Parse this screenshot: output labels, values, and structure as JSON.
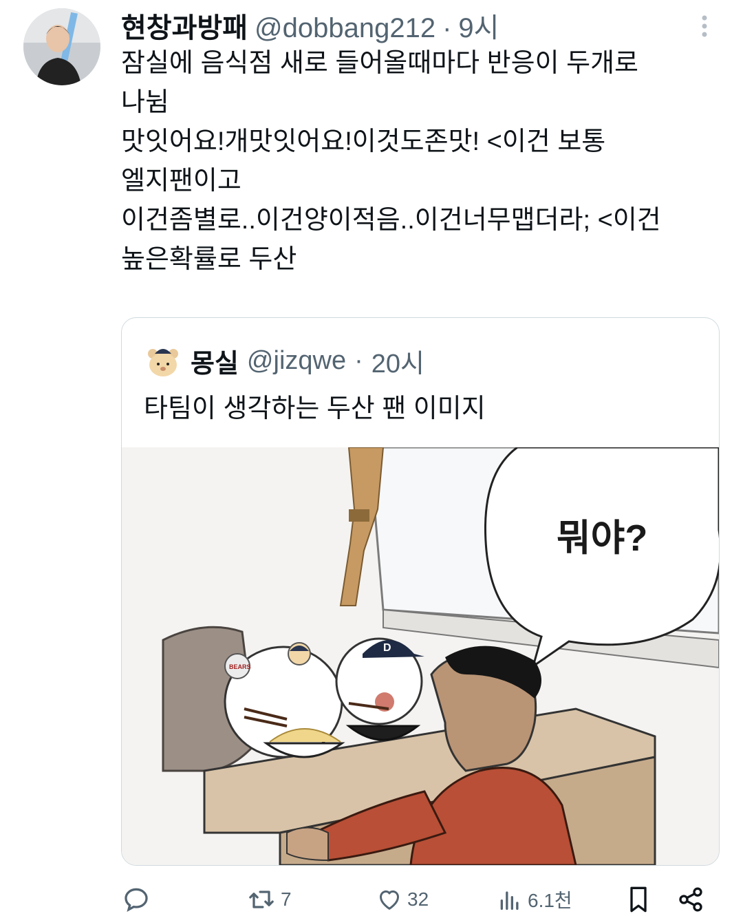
{
  "tweet": {
    "author_name": "현창과방패",
    "author_handle": "@dobbang212",
    "separator": "·",
    "time": "9시",
    "lines": [
      "잠실에 음식점 새로 들어올때마다 반응이 두개로",
      "나뉨",
      "맛잇어요!개맛잇어요!이것도존맛! <이건 보통",
      "엘지팬이고",
      "이건좀별로..이건양이적음..이건너무맵더라; <이건",
      "높은확률로 두산"
    ]
  },
  "quote": {
    "author_name": "몽실",
    "author_handle": "@jizqwe",
    "separator": "·",
    "time": "20시",
    "text": "타팀이 생각하는 두산 팬 이미지",
    "image": {
      "speech_bubble": "뭐야?",
      "cap_letter": "D",
      "ball_text": "BEARS"
    }
  },
  "actions": {
    "reply_count": "",
    "retweet_count": "7",
    "like_count": "32",
    "views_count": "6.1천"
  },
  "icons": [
    "more-vertical-icon",
    "reply-icon",
    "retweet-icon",
    "like-icon",
    "views-icon",
    "bookmark-icon",
    "share-icon"
  ],
  "colors": {
    "text": "#0f1419",
    "secondary": "#536471",
    "border": "#cfd9de"
  }
}
